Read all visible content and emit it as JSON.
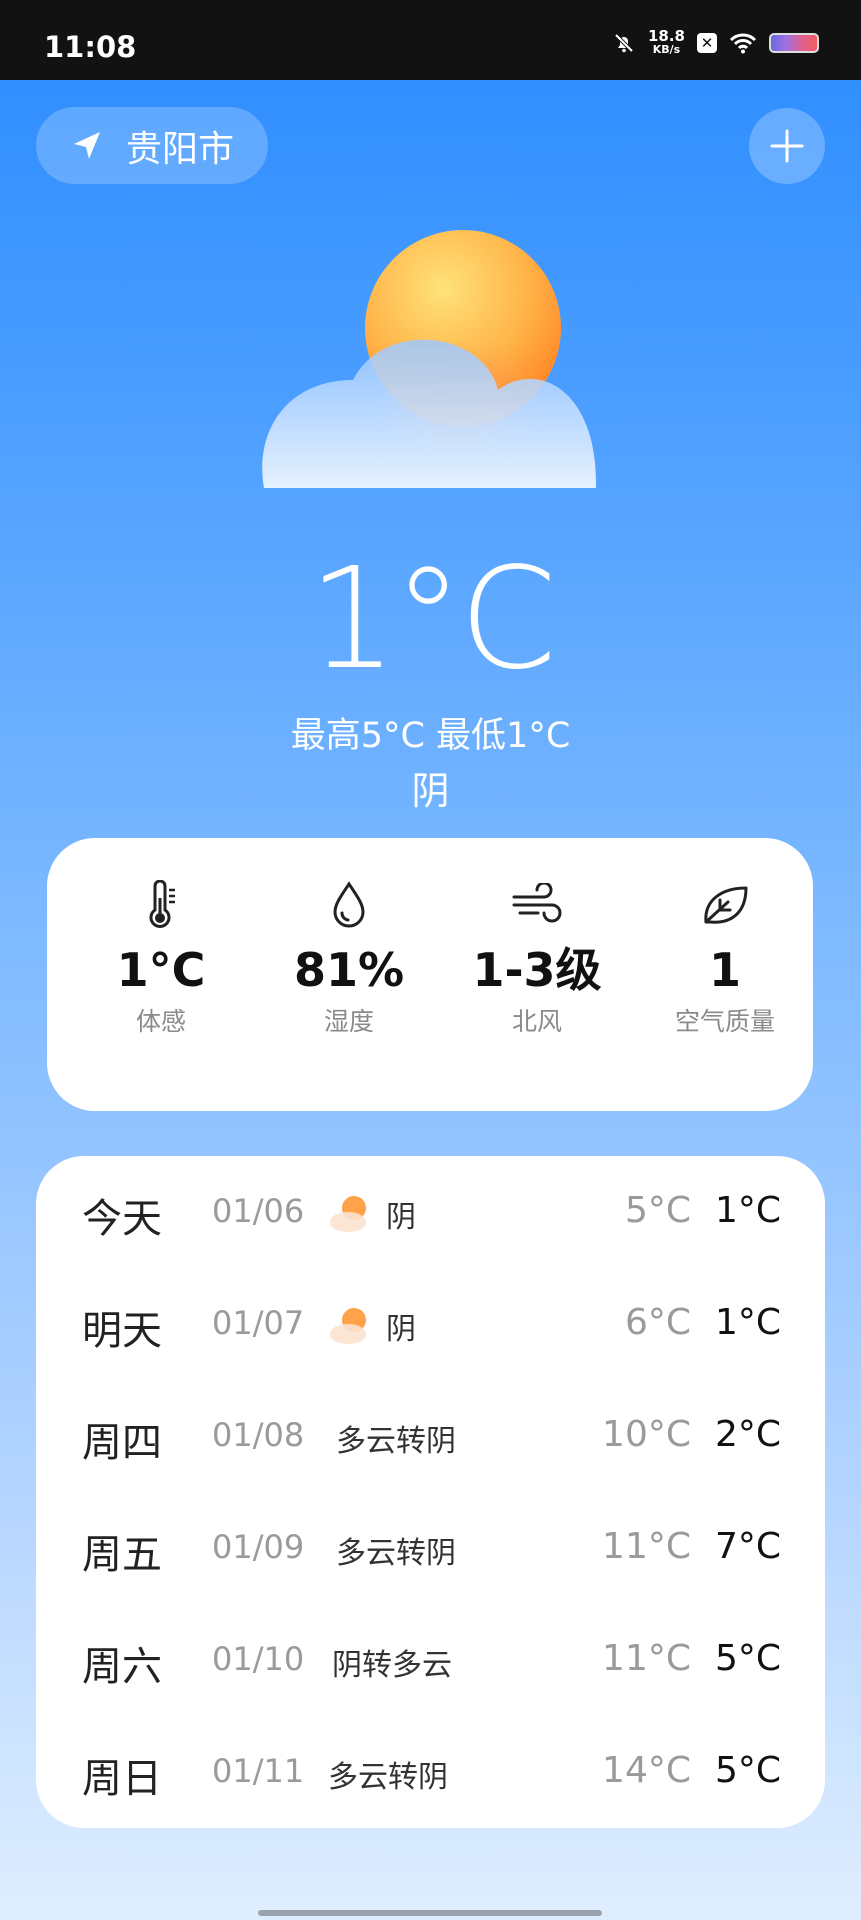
{
  "status_bar": {
    "time": "11:08",
    "net_speed_value": "18.8",
    "net_speed_unit": "KB/s",
    "x_badge": "✕"
  },
  "header": {
    "city": "贵阳市",
    "add_label": "+"
  },
  "current": {
    "temperature": "1°C",
    "hi_lo": "最高5°C 最低1°C",
    "condition": "阴",
    "illustration": "sun-behind-cloud"
  },
  "details": [
    {
      "icon": "thermometer-icon",
      "value": "1°C",
      "label": "体感"
    },
    {
      "icon": "water-drop-icon",
      "value": "81%",
      "label": "湿度"
    },
    {
      "icon": "wind-icon",
      "value": "1-3级",
      "label": "北风"
    },
    {
      "icon": "leaf-icon",
      "value": "1",
      "label": "空气质量"
    }
  ],
  "forecast": [
    {
      "day": "今天",
      "date": "01/06",
      "icon": "sun-cloud-icon",
      "condition": "阴",
      "high": "5°C",
      "low": "1°C"
    },
    {
      "day": "明天",
      "date": "01/07",
      "icon": "sun-cloud-icon",
      "condition": "阴",
      "high": "6°C",
      "low": "1°C"
    },
    {
      "day": "周四",
      "date": "01/08",
      "icon": "",
      "condition": "多云转阴",
      "high": "10°C",
      "low": "2°C"
    },
    {
      "day": "周五",
      "date": "01/09",
      "icon": "",
      "condition": "多云转阴",
      "high": "11°C",
      "low": "7°C"
    },
    {
      "day": "周六",
      "date": "01/10",
      "icon": "",
      "condition": "阴转多云",
      "high": "11°C",
      "low": "5°C"
    },
    {
      "day": "周日",
      "date": "01/11",
      "icon": "",
      "condition": "多云转阴",
      "high": "14°C",
      "low": "5°C"
    }
  ],
  "colors": {
    "bg_top": "#2a8bff",
    "bg_bottom": "#dfeeff",
    "sun": "#ff8a2a",
    "card": "#ffffff"
  }
}
